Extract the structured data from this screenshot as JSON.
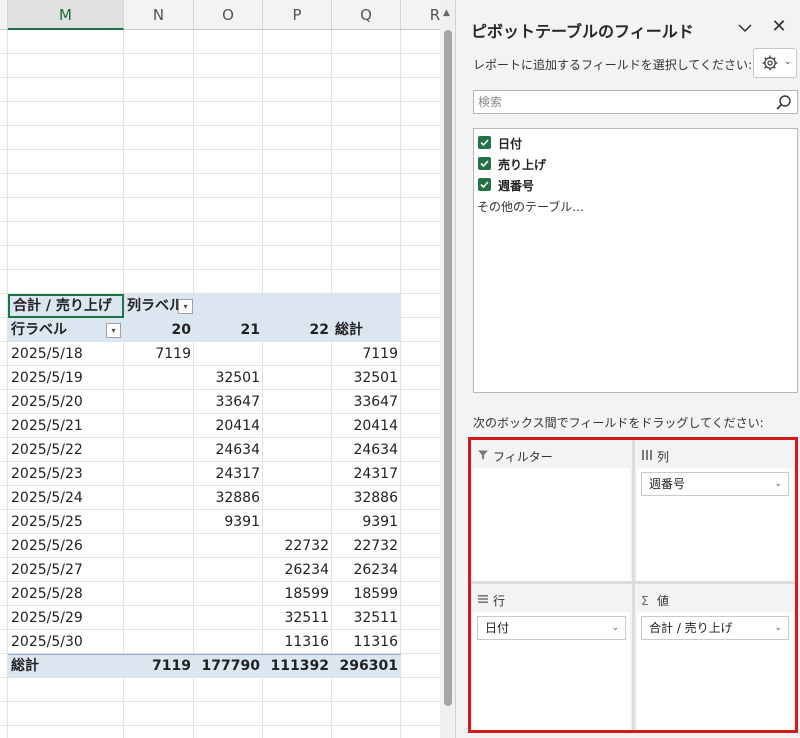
{
  "sheet": {
    "columns": [
      "M",
      "N",
      "O",
      "P",
      "Q",
      "R"
    ],
    "selected_column": "M",
    "pivot": {
      "corner_label": "合計 / 売り上げ",
      "col_label": "列ラベル",
      "row_label": "行ラベル",
      "col_keys": [
        "20",
        "21",
        "22"
      ],
      "grand_total_col": "総計",
      "rows": [
        {
          "date": "2025/5/18",
          "v20": "7119",
          "v21": "",
          "v22": "",
          "total": "7119"
        },
        {
          "date": "2025/5/19",
          "v20": "",
          "v21": "32501",
          "v22": "",
          "total": "32501"
        },
        {
          "date": "2025/5/20",
          "v20": "",
          "v21": "33647",
          "v22": "",
          "total": "33647"
        },
        {
          "date": "2025/5/21",
          "v20": "",
          "v21": "20414",
          "v22": "",
          "total": "20414"
        },
        {
          "date": "2025/5/22",
          "v20": "",
          "v21": "24634",
          "v22": "",
          "total": "24634"
        },
        {
          "date": "2025/5/23",
          "v20": "",
          "v21": "24317",
          "v22": "",
          "total": "24317"
        },
        {
          "date": "2025/5/24",
          "v20": "",
          "v21": "32886",
          "v22": "",
          "total": "32886"
        },
        {
          "date": "2025/5/25",
          "v20": "",
          "v21": "9391",
          "v22": "",
          "total": "9391"
        },
        {
          "date": "2025/5/26",
          "v20": "",
          "v21": "",
          "v22": "22732",
          "total": "22732"
        },
        {
          "date": "2025/5/27",
          "v20": "",
          "v21": "",
          "v22": "26234",
          "total": "26234"
        },
        {
          "date": "2025/5/28",
          "v20": "",
          "v21": "",
          "v22": "18599",
          "total": "18599"
        },
        {
          "date": "2025/5/29",
          "v20": "",
          "v21": "",
          "v22": "32511",
          "total": "32511"
        },
        {
          "date": "2025/5/30",
          "v20": "",
          "v21": "",
          "v22": "11316",
          "total": "11316"
        }
      ],
      "grand_total": {
        "label": "総計",
        "v20": "7119",
        "v21": "177790",
        "v22": "111392",
        "total": "296301"
      }
    }
  },
  "pane": {
    "title": "ピボットテーブルのフィールド",
    "subtitle": "レポートに追加するフィールドを選択してください:",
    "search_placeholder": "検索",
    "fields": [
      {
        "label": "日付",
        "checked": true
      },
      {
        "label": "売り上げ",
        "checked": true
      },
      {
        "label": "週番号",
        "checked": true
      }
    ],
    "more_tables": "その他のテーブル...",
    "drag_hint": "次のボックス間でフィールドをドラッグしてください:",
    "areas": {
      "filter": {
        "label": "フィルター",
        "icon": "filter-icon",
        "items": []
      },
      "columns": {
        "label": "列",
        "icon": "columns-icon",
        "items": [
          "週番号"
        ]
      },
      "rows": {
        "label": "行",
        "icon": "rows-icon",
        "items": [
          "日付"
        ]
      },
      "values": {
        "label": "値",
        "icon": "sigma-icon",
        "items": [
          "合計 / 売り上げ"
        ]
      }
    },
    "accent_color": "#217346",
    "highlight_color": "#d41b1b"
  }
}
